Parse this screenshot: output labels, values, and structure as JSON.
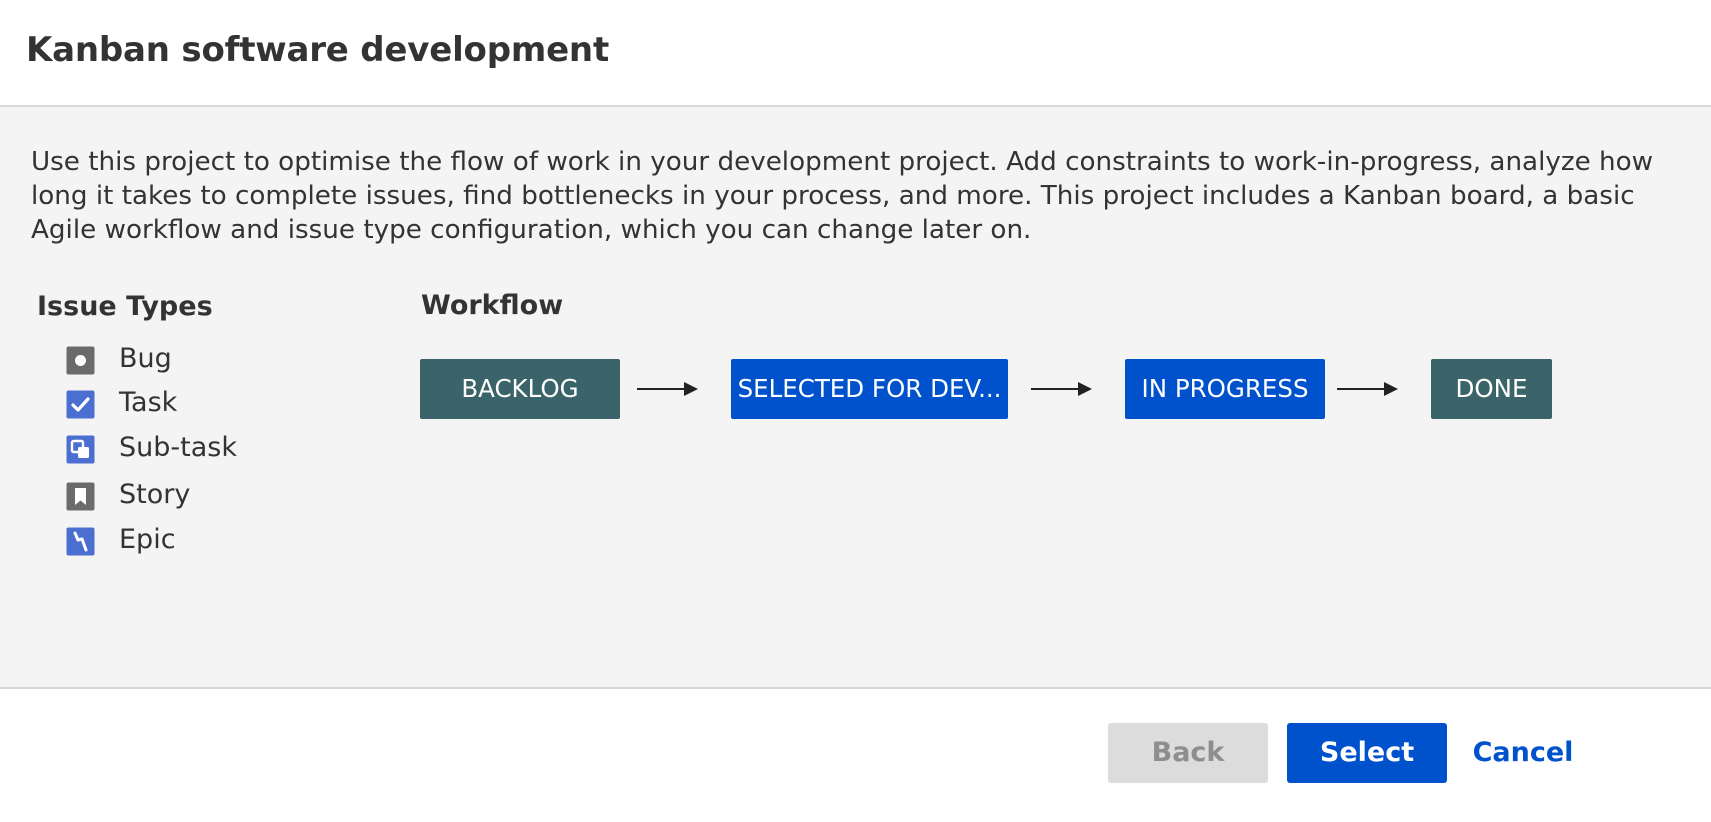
{
  "dialog": {
    "title": "Kanban software development",
    "description": "Use this project to optimise the flow of work in your development project. Add constraints to work-in-progress, analyze how long it takes to complete issues, find bottlenecks in your process, and more. This project includes a Kanban board, a basic Agile workflow and issue type configuration, which you can change later on."
  },
  "issue_types": {
    "heading": "Issue Types",
    "items": [
      {
        "label": "Bug",
        "icon": "bug-icon",
        "color": "#6b6b6b"
      },
      {
        "label": "Task",
        "icon": "task-icon",
        "color": "#4a6fd0"
      },
      {
        "label": "Sub-task",
        "icon": "subtask-icon",
        "color": "#4a6fd0"
      },
      {
        "label": "Story",
        "icon": "story-icon",
        "color": "#6b6b6b"
      },
      {
        "label": "Epic",
        "icon": "epic-icon",
        "color": "#4a6fd0"
      }
    ]
  },
  "workflow": {
    "heading": "Workflow",
    "statuses": [
      {
        "label": "BACKLOG",
        "color": "#3a6469"
      },
      {
        "label": "SELECTED FOR DEV...",
        "color": "#0052cc"
      },
      {
        "label": "IN PROGRESS",
        "color": "#0052cc"
      },
      {
        "label": "DONE",
        "color": "#3a6469"
      }
    ]
  },
  "footer": {
    "back_label": "Back",
    "select_label": "Select",
    "cancel_label": "Cancel"
  }
}
